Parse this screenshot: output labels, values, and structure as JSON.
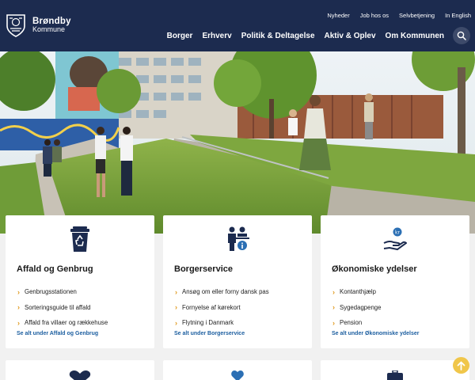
{
  "header": {
    "logo": {
      "name": "Brøndby",
      "sub": "Kommune"
    },
    "top_links": [
      "Nyheder",
      "Job hos os",
      "Selvbetjening",
      "In English"
    ],
    "main_nav": [
      "Borger",
      "Erhverv",
      "Politik & Deltagelse",
      "Aktiv & Oplev",
      "Om Kommunen"
    ],
    "search_icon": "search-icon"
  },
  "cards": [
    {
      "icon": "recycle-bin-icon",
      "title": "Affald og Genbrug",
      "links": [
        "Genbrugsstationen",
        "Sorteringsguide til affald",
        "Affald fra villaer og rækkehuse"
      ],
      "more": "Se alt under Affald og Genbrug"
    },
    {
      "icon": "citizen-service-icon",
      "title": "Borgerservice",
      "links": [
        "Ansøg om eller forny dansk pas",
        "Fornyelse af kørekort",
        "Flytning i Danmark"
      ],
      "more": "Se alt under Borgerservice"
    },
    {
      "icon": "money-hand-icon",
      "title": "Økonomiske ydelser",
      "links": [
        "Kontanthjælp",
        "Sygedagpenge",
        "Pension"
      ],
      "more": "Se alt under Økonomiske ydelser"
    }
  ],
  "colors": {
    "header_bg": "#1c2b4f",
    "accent_chevron": "#e09a1f",
    "link_blue": "#1d5fa0",
    "scroll_button": "#f0c64a"
  }
}
